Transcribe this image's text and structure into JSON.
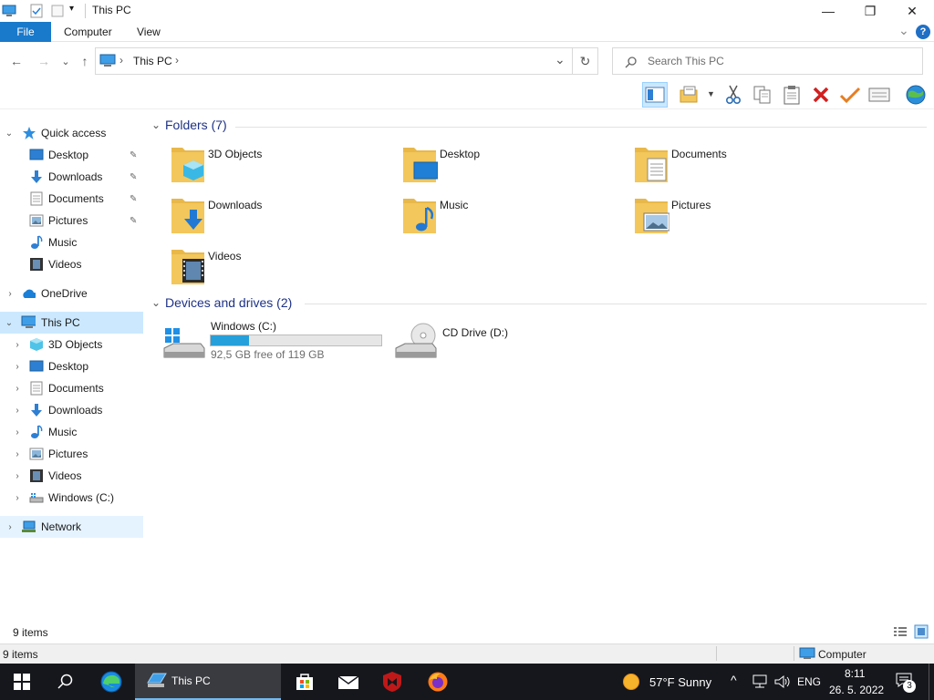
{
  "window": {
    "title": "This PC",
    "minimize_glyph": "—",
    "maximize_glyph": "❐",
    "close_glyph": "✕"
  },
  "ribbon": {
    "tabs": [
      "File",
      "Computer",
      "View"
    ],
    "help_glyph": "?",
    "collapse_glyph": "⌄"
  },
  "address": {
    "crumb": "This PC",
    "crumb_sep": "›",
    "dropdown_glyph": "⌄",
    "refresh_glyph": "↻",
    "back_glyph": "←",
    "forward_glyph": "→",
    "recent_glyph": "⌄",
    "up_glyph": "↑"
  },
  "search": {
    "placeholder": "Search This PC"
  },
  "nav": {
    "quick_access": "Quick access",
    "quick_items": [
      "Desktop",
      "Downloads",
      "Documents",
      "Pictures",
      "Music",
      "Videos"
    ],
    "onedrive": "OneDrive",
    "this_pc": "This PC",
    "pc_items": [
      "3D Objects",
      "Desktop",
      "Documents",
      "Downloads",
      "Music",
      "Pictures",
      "Videos",
      "Windows (C:)"
    ],
    "network": "Network",
    "chev_open": "⌄",
    "chev_closed": "›",
    "pin_glyph": "📌"
  },
  "folders": {
    "heading": "Folders (7)",
    "items": [
      "3D Objects",
      "Desktop",
      "Documents",
      "Downloads",
      "Music",
      "Pictures",
      "Videos"
    ],
    "collapse_glyph": "⌄"
  },
  "drives": {
    "heading": "Devices and drives (2)",
    "c_name": "Windows (C:)",
    "c_free": "92,5 GB free of 119 GB",
    "c_used_fraction": 0.223,
    "d_name": "CD Drive (D:)"
  },
  "status": {
    "items": "9 items",
    "items2": "9 items",
    "computer": "Computer"
  },
  "taskbar": {
    "app_label": "This PC",
    "weather": "57°F  Sunny",
    "lang": "ENG",
    "time": "8:11",
    "date": "26. 5. 2022",
    "notif_count": "3",
    "tray_up": "^"
  },
  "colors": {
    "accent": "#1979ca",
    "folder": "#f3c75b",
    "heading": "#1e3287",
    "progress": "#26a0da"
  }
}
